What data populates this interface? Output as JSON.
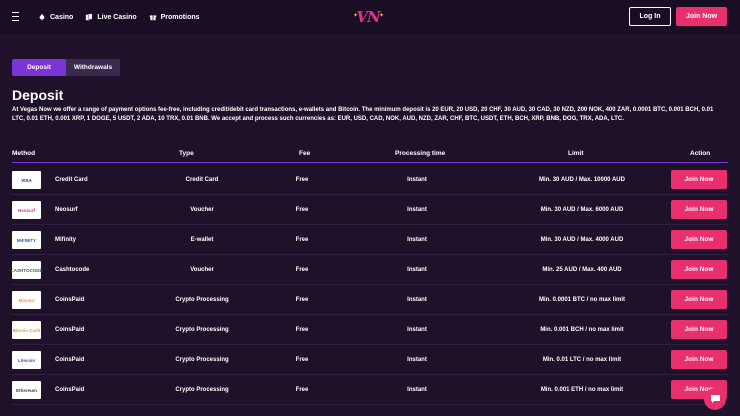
{
  "header": {
    "nav": [
      {
        "label": "Casino",
        "icon": "spade-icon"
      },
      {
        "label": "Live Casino",
        "icon": "cards-icon"
      },
      {
        "label": "Promotions",
        "icon": "gift-icon"
      }
    ],
    "logo": "VN",
    "login_label": "Log In",
    "join_label": "Join Now"
  },
  "tabs": [
    {
      "label": "Deposit",
      "active": true
    },
    {
      "label": "Withdrawals",
      "active": false
    }
  ],
  "page_title": "Deposit",
  "intro": "At Vegas Now we offer a range of payment options fee-free, including credit/debit card transactions, e-wallets and Bitcoin. The minimum deposit is 20 EUR, 20 USD, 20 CHF, 30 AUD, 30 CAD, 30 NZD, 200 NOK, 400 ZAR, 0.0001 BTC, 0.001 BCH, 0.01 LTC, 0.01 ETH, 0.001 XRP, 1 DOGE, 5 USDT, 2 ADA, 10 TRX, 0.01 BNB. We accept and process such currencies as: EUR, USD, CAD, NOK, AUD, NZD, ZAR, CHF, BTC, USDT, ETH, BCH, XRP, BNB, DOG, TRX, ADA, LTC.",
  "table": {
    "headers": {
      "method": "Method",
      "type": "Type",
      "fee": "Fee",
      "time": "Processing time",
      "limit": "Limit",
      "action": "Action"
    },
    "rows": [
      {
        "method": "Credit Card",
        "type": "Credit Card",
        "fee": "Free",
        "time": "Instant",
        "limit": "Min. 30 AUD / Max. 10000 AUD",
        "action": "Join Now",
        "logo": "VISA",
        "logo_color": "#1a1f71"
      },
      {
        "method": "Neosurf",
        "type": "Voucher",
        "fee": "Free",
        "time": "Instant",
        "limit": "Min. 30 AUD / Max. 6000 AUD",
        "action": "Join Now",
        "logo": "Neosurf",
        "logo_color": "#e8306e"
      },
      {
        "method": "Mifinity",
        "type": "E-wallet",
        "fee": "Free",
        "time": "Instant",
        "limit": "Min. 30 AUD / Max. 4000 AUD",
        "action": "Join Now",
        "logo": "MiFINITY",
        "logo_color": "#2a5db0"
      },
      {
        "method": "Cashtocode",
        "type": "Voucher",
        "fee": "Free",
        "time": "Instant",
        "limit": "Min. 25 AUD / Max. 400 AUD",
        "action": "Join Now",
        "logo": "CASHTOCODE",
        "logo_color": "#555555"
      },
      {
        "method": "CoinsPaid",
        "type": "Crypto Processing",
        "fee": "Free",
        "time": "Instant",
        "limit": "Min. 0.0001 BTC / no max limit",
        "action": "Join Now",
        "logo": "Bitcoin",
        "logo_color": "#f7931a"
      },
      {
        "method": "CoinsPaid",
        "type": "Crypto Processing",
        "fee": "Free",
        "time": "Instant",
        "limit": "Min. 0.001 BCH / no max limit",
        "action": "Join Now",
        "logo": "Bitcoin Cash",
        "logo_color": "#f7931a"
      },
      {
        "method": "CoinsPaid",
        "type": "Crypto Processing",
        "fee": "Free",
        "time": "Instant",
        "limit": "Min. 0.01 LTC / no max limit",
        "action": "Join Now",
        "logo": "Litecoin",
        "logo_color": "#345d9d"
      },
      {
        "method": "CoinsPaid",
        "type": "Crypto Processing",
        "fee": "Free",
        "time": "Instant",
        "limit": "Min. 0.001 ETH / no max limit",
        "action": "Join Now",
        "logo": "Ethereum",
        "logo_color": "#3c3c3d"
      }
    ]
  }
}
